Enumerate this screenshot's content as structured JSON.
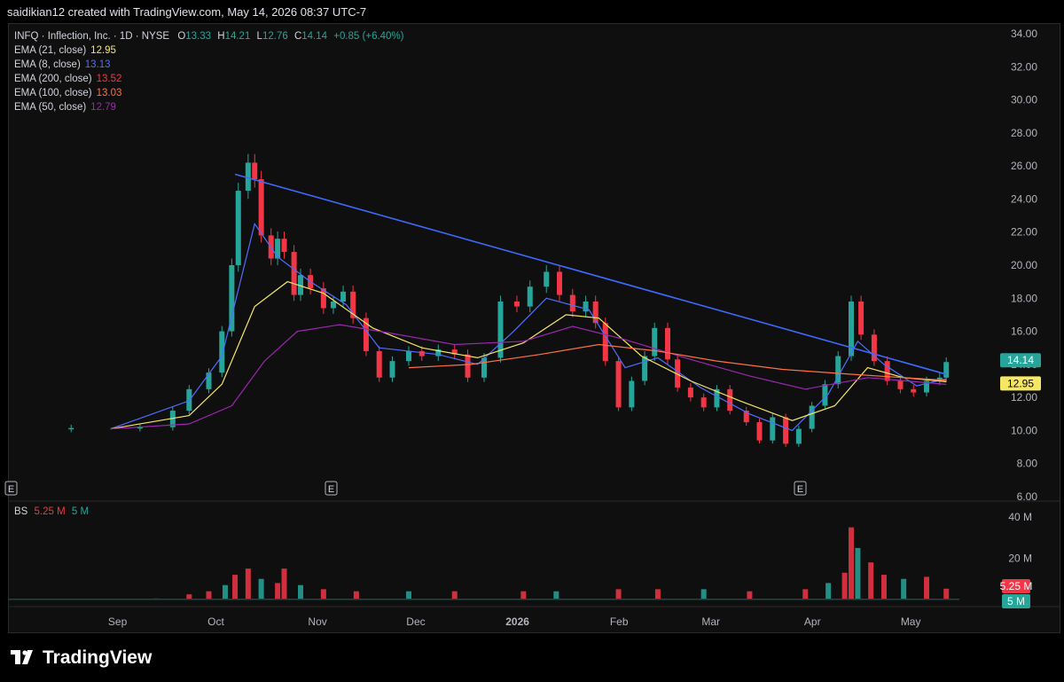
{
  "header": {
    "text": "saidikian12 created with TradingView.com, May 14, 2026 08:37 UTC-7"
  },
  "symbol_line": {
    "name": "INFQ · Inflection, Inc. · 1D · NYSE",
    "o_label": "O",
    "o": "13.33",
    "h_label": "H",
    "h": "14.21",
    "l_label": "L",
    "l": "12.76",
    "c_label": "C",
    "c": "14.14",
    "change": "+0.85 (+6.40%)"
  },
  "indicators": [
    {
      "label": "EMA (21, close)",
      "value": "12.95",
      "color": "#f5e663"
    },
    {
      "label": "EMA (8, close)",
      "value": "13.13",
      "color": "#4f6fff"
    },
    {
      "label": "EMA (200, close)",
      "value": "13.52",
      "color": "#f23645"
    },
    {
      "label": "EMA (100, close)",
      "value": "13.03",
      "color": "#ff7043"
    },
    {
      "label": "EMA (50, close)",
      "value": "12.79",
      "color": "#9c27b0"
    }
  ],
  "volume_legend": {
    "label": "BS",
    "v1": "5.25 M",
    "v2": "5 M"
  },
  "price_badges": {
    "last": "14.14",
    "ema21": "12.95"
  },
  "volume_badges": {
    "a": "5.25 M",
    "b": "5 M"
  },
  "earnings_markers": [
    "E",
    "E",
    "E"
  ],
  "footer": {
    "brand": "TradingView"
  },
  "colors": {
    "up": "#26a69a",
    "down": "#f23645",
    "trendline": "#3d6bff"
  },
  "chart_data": {
    "type": "candlestick",
    "title": "INFQ · Inflection, Inc. · 1D · NYSE",
    "y_axis": {
      "ticks": [
        "34.00",
        "32.00",
        "30.00",
        "28.00",
        "26.00",
        "24.00",
        "22.00",
        "20.00",
        "18.00",
        "16.00",
        "14.00",
        "12.00",
        "10.00",
        "8.00",
        "6.00"
      ],
      "range": [
        6,
        34
      ]
    },
    "volume_axis": {
      "ticks": [
        "40 M",
        "20 M"
      ],
      "range": [
        0,
        40
      ]
    },
    "x_axis": {
      "ticks": [
        "Sep",
        "Oct",
        "Nov",
        "Dec",
        "2026",
        "Feb",
        "Mar",
        "Apr",
        "May"
      ]
    },
    "price_series": [
      [
        "2025-08-01",
        10.1
      ],
      [
        "2025-08-20",
        10.15
      ],
      [
        "2025-09-10",
        10.2
      ],
      [
        "2025-09-20",
        11.2
      ],
      [
        "2025-09-25",
        12.5
      ],
      [
        "2025-10-01",
        13.5
      ],
      [
        "2025-10-05",
        16.0
      ],
      [
        "2025-10-08",
        20.0
      ],
      [
        "2025-10-10",
        24.5
      ],
      [
        "2025-10-13",
        26.2
      ],
      [
        "2025-10-15",
        25.2
      ],
      [
        "2025-10-17",
        21.8
      ],
      [
        "2025-10-20",
        20.4
      ],
      [
        "2025-10-22",
        21.6
      ],
      [
        "2025-10-24",
        20.8
      ],
      [
        "2025-10-27",
        18.2
      ],
      [
        "2025-10-29",
        19.4
      ],
      [
        "2025-11-01",
        18.6
      ],
      [
        "2025-11-05",
        17.4
      ],
      [
        "2025-11-08",
        17.8
      ],
      [
        "2025-11-11",
        18.4
      ],
      [
        "2025-11-14",
        16.8
      ],
      [
        "2025-11-18",
        14.8
      ],
      [
        "2025-11-22",
        13.2
      ],
      [
        "2025-11-26",
        14.2
      ],
      [
        "2025-12-01",
        14.8
      ],
      [
        "2025-12-05",
        14.5
      ],
      [
        "2025-12-10",
        14.9
      ],
      [
        "2025-12-15",
        14.6
      ],
      [
        "2025-12-19",
        13.2
      ],
      [
        "2025-12-24",
        14.4
      ],
      [
        "2025-12-29",
        17.8
      ],
      [
        "2026-01-03",
        17.5
      ],
      [
        "2026-01-07",
        18.7
      ],
      [
        "2026-01-12",
        19.6
      ],
      [
        "2026-01-16",
        18.2
      ],
      [
        "2026-01-20",
        17.2
      ],
      [
        "2026-01-24",
        17.8
      ],
      [
        "2026-01-27",
        16.5
      ],
      [
        "2026-01-30",
        14.2
      ],
      [
        "2026-02-03",
        11.4
      ],
      [
        "2026-02-07",
        13.0
      ],
      [
        "2026-02-11",
        14.5
      ],
      [
        "2026-02-14",
        16.2
      ],
      [
        "2026-02-18",
        14.3
      ],
      [
        "2026-02-21",
        12.6
      ],
      [
        "2026-02-25",
        12.0
      ],
      [
        "2026-03-01",
        11.4
      ],
      [
        "2026-03-05",
        12.5
      ],
      [
        "2026-03-09",
        11.2
      ],
      [
        "2026-03-14",
        10.5
      ],
      [
        "2026-03-18",
        9.4
      ],
      [
        "2026-03-22",
        10.8
      ],
      [
        "2026-03-26",
        9.2
      ],
      [
        "2026-03-30",
        10.1
      ],
      [
        "2026-04-03",
        11.5
      ],
      [
        "2026-04-07",
        12.8
      ],
      [
        "2026-04-11",
        14.5
      ],
      [
        "2026-04-15",
        17.8
      ],
      [
        "2026-04-18",
        15.8
      ],
      [
        "2026-04-22",
        14.2
      ],
      [
        "2026-04-26",
        13.0
      ],
      [
        "2026-04-30",
        12.5
      ],
      [
        "2026-05-04",
        12.3
      ],
      [
        "2026-05-08",
        13.0
      ],
      [
        "2026-05-12",
        13.2
      ],
      [
        "2026-05-14",
        14.14
      ]
    ],
    "ema_lines": [
      {
        "name": "EMA (8, close)",
        "color": "#4f6fff",
        "points": [
          [
            "2025-09-01",
            10.1
          ],
          [
            "2025-09-25",
            11.8
          ],
          [
            "2025-10-05",
            14.5
          ],
          [
            "2025-10-15",
            22.5
          ],
          [
            "2025-10-22",
            20.5
          ],
          [
            "2025-11-01",
            19.0
          ],
          [
            "2025-11-12",
            17.6
          ],
          [
            "2025-11-22",
            15.0
          ],
          [
            "2025-12-10",
            14.6
          ],
          [
            "2025-12-22",
            14.0
          ],
          [
            "2026-01-02",
            16.0
          ],
          [
            "2026-01-12",
            18.0
          ],
          [
            "2026-01-25",
            17.3
          ],
          [
            "2026-02-05",
            13.8
          ],
          [
            "2026-02-15",
            14.4
          ],
          [
            "2026-02-28",
            12.6
          ],
          [
            "2026-03-15",
            11.0
          ],
          [
            "2026-03-28",
            10.0
          ],
          [
            "2026-04-08",
            12.2
          ],
          [
            "2026-04-17",
            15.4
          ],
          [
            "2026-04-25",
            14.0
          ],
          [
            "2026-05-05",
            12.7
          ],
          [
            "2026-05-14",
            13.13
          ]
        ]
      },
      {
        "name": "EMA (21, close)",
        "color": "#f5e663",
        "points": [
          [
            "2025-09-01",
            10.1
          ],
          [
            "2025-09-25",
            10.9
          ],
          [
            "2025-10-05",
            12.8
          ],
          [
            "2025-10-15",
            17.5
          ],
          [
            "2025-10-25",
            19.0
          ],
          [
            "2025-11-05",
            18.3
          ],
          [
            "2025-11-20",
            16.2
          ],
          [
            "2025-12-05",
            15.0
          ],
          [
            "2025-12-22",
            14.4
          ],
          [
            "2026-01-05",
            15.3
          ],
          [
            "2026-01-18",
            17.0
          ],
          [
            "2026-01-28",
            16.8
          ],
          [
            "2026-02-10",
            14.5
          ],
          [
            "2026-02-25",
            13.0
          ],
          [
            "2026-03-12",
            11.8
          ],
          [
            "2026-03-28",
            10.6
          ],
          [
            "2026-04-10",
            11.5
          ],
          [
            "2026-04-20",
            13.8
          ],
          [
            "2026-05-01",
            13.2
          ],
          [
            "2026-05-14",
            12.95
          ]
        ]
      },
      {
        "name": "EMA (50, close)",
        "color": "#9c27b0",
        "points": [
          [
            "2025-09-01",
            10.1
          ],
          [
            "2025-09-25",
            10.4
          ],
          [
            "2025-10-08",
            11.5
          ],
          [
            "2025-10-18",
            14.2
          ],
          [
            "2025-10-28",
            16.0
          ],
          [
            "2025-11-10",
            16.4
          ],
          [
            "2025-11-25",
            15.9
          ],
          [
            "2025-12-15",
            15.2
          ],
          [
            "2026-01-05",
            15.4
          ],
          [
            "2026-01-20",
            16.3
          ],
          [
            "2026-02-05",
            15.5
          ],
          [
            "2026-02-25",
            14.3
          ],
          [
            "2026-03-15",
            13.3
          ],
          [
            "2026-04-01",
            12.5
          ],
          [
            "2026-04-20",
            13.2
          ],
          [
            "2026-05-14",
            12.79
          ]
        ]
      },
      {
        "name": "EMA (100, close)",
        "color": "#ff7043",
        "points": [
          [
            "2025-12-01",
            13.8
          ],
          [
            "2025-12-20",
            14.0
          ],
          [
            "2026-01-10",
            14.6
          ],
          [
            "2026-01-28",
            15.2
          ],
          [
            "2026-02-15",
            14.8
          ],
          [
            "2026-03-05",
            14.2
          ],
          [
            "2026-03-25",
            13.7
          ],
          [
            "2026-04-15",
            13.4
          ],
          [
            "2026-05-14",
            13.03
          ]
        ]
      }
    ],
    "trendline": {
      "from": [
        "2025-10-09",
        25.5
      ],
      "to": [
        "2026-05-14",
        13.4
      ]
    },
    "volume_series": [
      [
        "2025-09-15",
        0.5
      ],
      [
        "2025-09-25",
        2.5
      ],
      [
        "2025-10-01",
        4
      ],
      [
        "2025-10-06",
        7
      ],
      [
        "2025-10-09",
        12
      ],
      [
        "2025-10-13",
        15
      ],
      [
        "2025-10-17",
        10
      ],
      [
        "2025-10-22",
        8
      ],
      [
        "2025-10-24",
        15
      ],
      [
        "2025-10-29",
        7
      ],
      [
        "2025-11-05",
        5
      ],
      [
        "2025-11-15",
        4
      ],
      [
        "2025-12-01",
        4
      ],
      [
        "2025-12-15",
        4
      ],
      [
        "2026-01-05",
        4
      ],
      [
        "2026-01-15",
        4
      ],
      [
        "2026-02-03",
        5
      ],
      [
        "2026-02-15",
        5
      ],
      [
        "2026-03-01",
        5
      ],
      [
        "2026-03-15",
        4
      ],
      [
        "2026-04-01",
        5
      ],
      [
        "2026-04-08",
        8
      ],
      [
        "2026-04-13",
        13
      ],
      [
        "2026-04-15",
        35
      ],
      [
        "2026-04-17",
        25
      ],
      [
        "2026-04-21",
        18
      ],
      [
        "2026-04-25",
        12
      ],
      [
        "2026-05-01",
        10
      ],
      [
        "2026-05-08",
        11
      ],
      [
        "2026-05-14",
        5.25
      ]
    ]
  }
}
